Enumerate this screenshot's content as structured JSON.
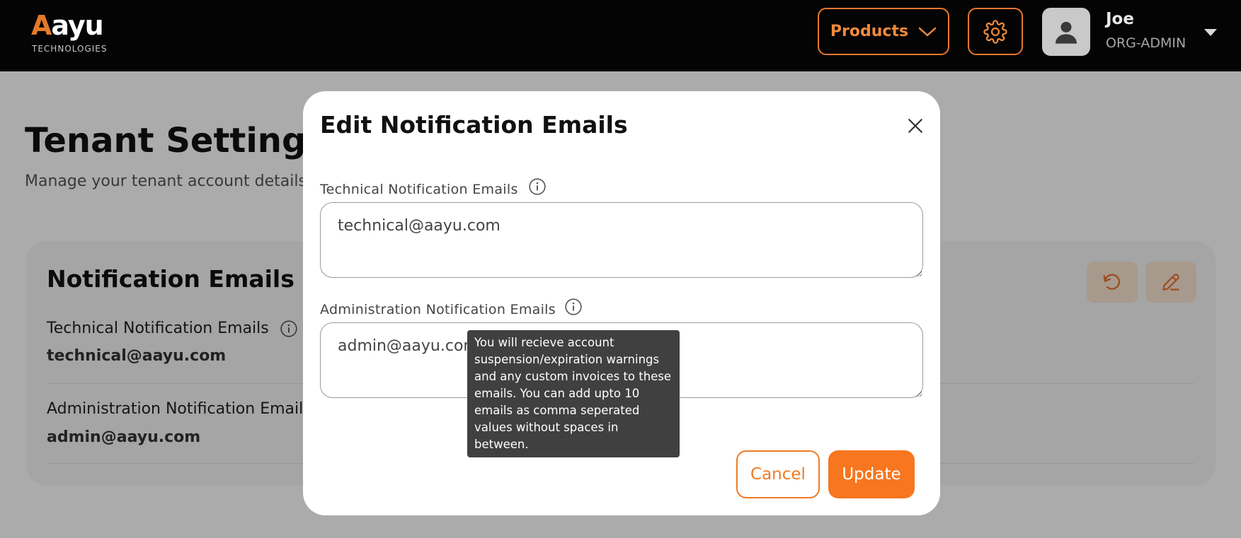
{
  "header": {
    "logo": {
      "initial": "A",
      "rest": "ayu",
      "subtitle": "TECHNOLOGIES"
    },
    "products_label": "Products",
    "user": {
      "name": "Joe",
      "role": "ORG-ADMIN"
    }
  },
  "page": {
    "title": "Tenant Settings",
    "subtitle": "Manage your tenant account details",
    "card": {
      "title": "Notification Emails",
      "fields": [
        {
          "label": "Technical Notification Emails",
          "value": "technical@aayu.com"
        },
        {
          "label": "Administration Notification Emails",
          "value": "admin@aayu.com"
        }
      ]
    }
  },
  "modal": {
    "title": "Edit Notification Emails",
    "technical": {
      "label": "Technical Notification Emails",
      "value": "technical@aayu.com"
    },
    "administration": {
      "label": "Administration Notification Emails",
      "value": "admin@aayu.com"
    },
    "cancel_label": "Cancel",
    "update_label": "Update"
  },
  "tooltip": {
    "text": "You will recieve account suspension/expiration warnings and any custom invoices to these emails. You can add upto 10 emails as comma seperated values without spaces in between."
  },
  "colors": {
    "accent": "#f7761f",
    "topbar": "#040404",
    "tooltip_bg": "#404040"
  },
  "icons": [
    "chevron-down-icon",
    "gear-icon",
    "user-icon",
    "caret-down-icon",
    "reset-icon",
    "edit-pencil-icon",
    "info-icon",
    "close-icon"
  ]
}
